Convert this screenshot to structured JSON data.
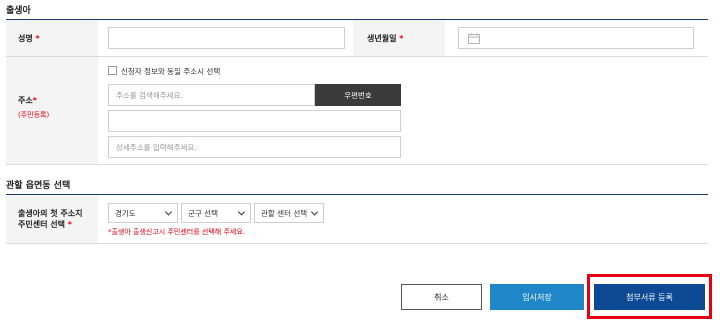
{
  "section1": {
    "title": "출생아",
    "name_label": "성명",
    "birth_label": "생년월일",
    "required_mark": "*",
    "address_label": "주소",
    "address_sub": "(주민등록)",
    "same_address_checkbox": "신청자 정보와 동일 주소시 선택",
    "address_search_placeholder": "주소를 검색해주세요.",
    "postal_button": "우편번호",
    "detail_address_placeholder": "상세주소를 입력해주세요."
  },
  "section2": {
    "title": "관할 읍면동 선택",
    "center_label_line1": "출생아의 첫 주소지",
    "center_label_line2": "주민센터 선택",
    "required_mark": "*",
    "province_select": "경기도",
    "district_select": "군구 선택",
    "center_select": "관할 센터 선택",
    "notice": "*출생아 출생신고시 주민센터를 선택해 주세요."
  },
  "actions": {
    "cancel": "취소",
    "temp_save": "임시저장",
    "attach": "첨부서류 등록"
  },
  "colors": {
    "accent": "#0d4a93",
    "accent_light": "#1f86c8",
    "required": "#e60012",
    "highlight": "#e60012"
  },
  "icons": {
    "calendar": "calendar-icon",
    "chevron": "chevron-down-icon"
  }
}
